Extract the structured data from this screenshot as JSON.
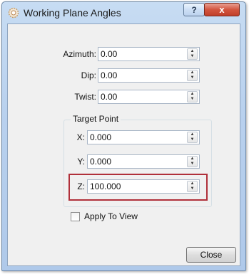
{
  "window": {
    "title": "Working Plane Angles",
    "help_label": "?",
    "close_glyph": "x"
  },
  "fields": {
    "azimuth": {
      "label": "Azimuth:",
      "value": "0.00"
    },
    "dip": {
      "label": "Dip:",
      "value": "0.00"
    },
    "twist": {
      "label": "Twist:",
      "value": "0.00"
    }
  },
  "target_point": {
    "title": "Target Point",
    "x": {
      "label": "X:",
      "value": "0.000"
    },
    "y": {
      "label": "Y:",
      "value": "0.000"
    },
    "z": {
      "label": "Z:",
      "value": "100.000"
    }
  },
  "apply_to_view": {
    "label": "Apply To View",
    "checked": false
  },
  "close_button": {
    "label": "Close"
  },
  "colors": {
    "highlight": "#b0303a",
    "title_close": "#c13f2a"
  },
  "icons": {
    "app": "gear-sun-icon",
    "spin_up": "spin-up-icon",
    "spin_down": "spin-down-icon"
  }
}
